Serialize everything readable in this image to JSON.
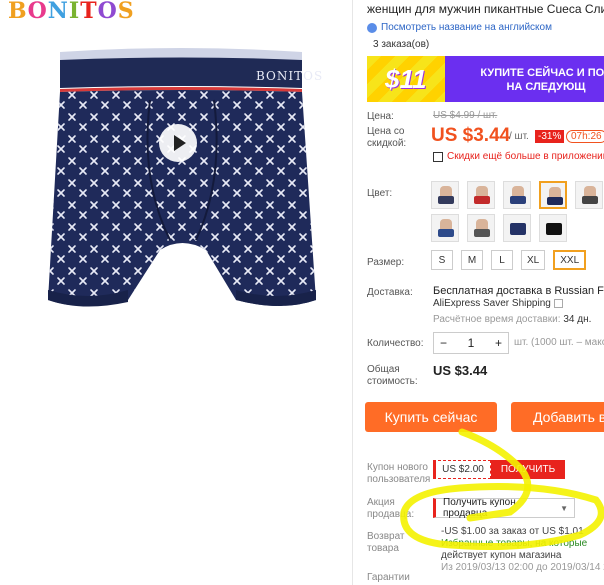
{
  "brand": {
    "letters": [
      "B",
      "O",
      "N",
      "I",
      "T",
      "O",
      "S"
    ],
    "colors": [
      "#f0a020",
      "#e83a8c",
      "#3fa0e0",
      "#7ab330",
      "#e8231d",
      "#8f4ad1",
      "#f0a020"
    ]
  },
  "product": {
    "title": "женщин для мужчин пикантные Cueca Cли",
    "translate_link": "Посмотреть название на английском",
    "orders": "3 заказа(ов)",
    "waistband_text": "BONITOS"
  },
  "promo": {
    "amount": "$11",
    "text_line1": "КУПИТЕ СЕЙЧАС И ПОЛ",
    "text_line2": "НА СЛЕДУЮЩ"
  },
  "price": {
    "label_price": "Цена:",
    "old": "US $4.99 / шт.",
    "label_discount": "Цена со скидкой:",
    "new": "US $3.44",
    "unit": "/ шт.",
    "discount": "-31%",
    "timer": "07h:26",
    "app_note": "Скидки ещё больше в приложении"
  },
  "color": {
    "label": "Цвет:"
  },
  "size": {
    "label": "Размер:",
    "options": [
      "S",
      "M",
      "L",
      "XL",
      "XXL"
    ],
    "selected": "XXL"
  },
  "shipping": {
    "label": "Доставка:",
    "line1": "Бесплатная доставка в Russian Fede",
    "line2": "AliExpress Saver Shipping",
    "time_label": "Расчётное время доставки:",
    "time_value": "34 дн."
  },
  "quantity": {
    "label": "Количество:",
    "value": "1",
    "minus": "−",
    "plus": "+",
    "note": "шт. (1000 шт. – макс"
  },
  "total": {
    "label": "Общая стоимость:",
    "value": "US $3.44"
  },
  "buttons": {
    "buy": "Купить сейчас",
    "cart": "Добавить в"
  },
  "coupon": {
    "label": "Купон нового пользователя",
    "value": "US $2.00",
    "action": "ПОЛУЧИТЬ"
  },
  "seller": {
    "label": "Акция продавца:",
    "select": "Получить купон продавца",
    "note_line1": "-US $1.00 за заказ от US $1.01",
    "note_line2": "Избранные товары, на которые",
    "note_line3": "действует купон магазина",
    "note_date": "Из 2019/03/13 02:00 до 2019/03/14 2"
  },
  "return": {
    "label": "Возврат товара"
  },
  "guarantee": {
    "label": "Гарантии"
  },
  "colors": {
    "accent": "#ff6c26",
    "price": "#f1521f",
    "red": "#e8231d",
    "highlight": "#f4f200",
    "promo": "#6b2ff0",
    "link": "#2d66c6"
  }
}
